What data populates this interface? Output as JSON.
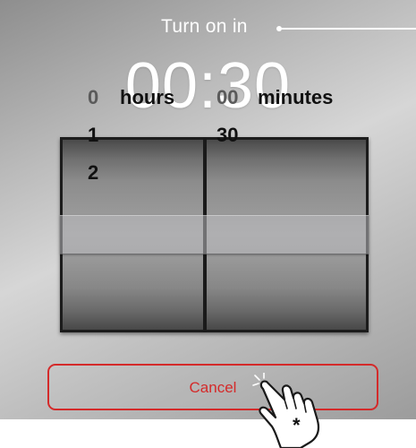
{
  "caption": {
    "text": "Turn on in"
  },
  "timer": {
    "value": "00:30"
  },
  "picker": {
    "hours": {
      "selected": "0",
      "label": "hours",
      "below": [
        "1",
        "2"
      ]
    },
    "minutes": {
      "selected": "00",
      "label": "minutes",
      "below": [
        "30"
      ]
    }
  },
  "cancel": {
    "label": "Cancel"
  },
  "annotation": {
    "marker": "*"
  },
  "colors": {
    "accent": "#d42a2a",
    "text_light": "#ffffff"
  },
  "icons": {
    "pointer": "tap-hand-icon"
  }
}
